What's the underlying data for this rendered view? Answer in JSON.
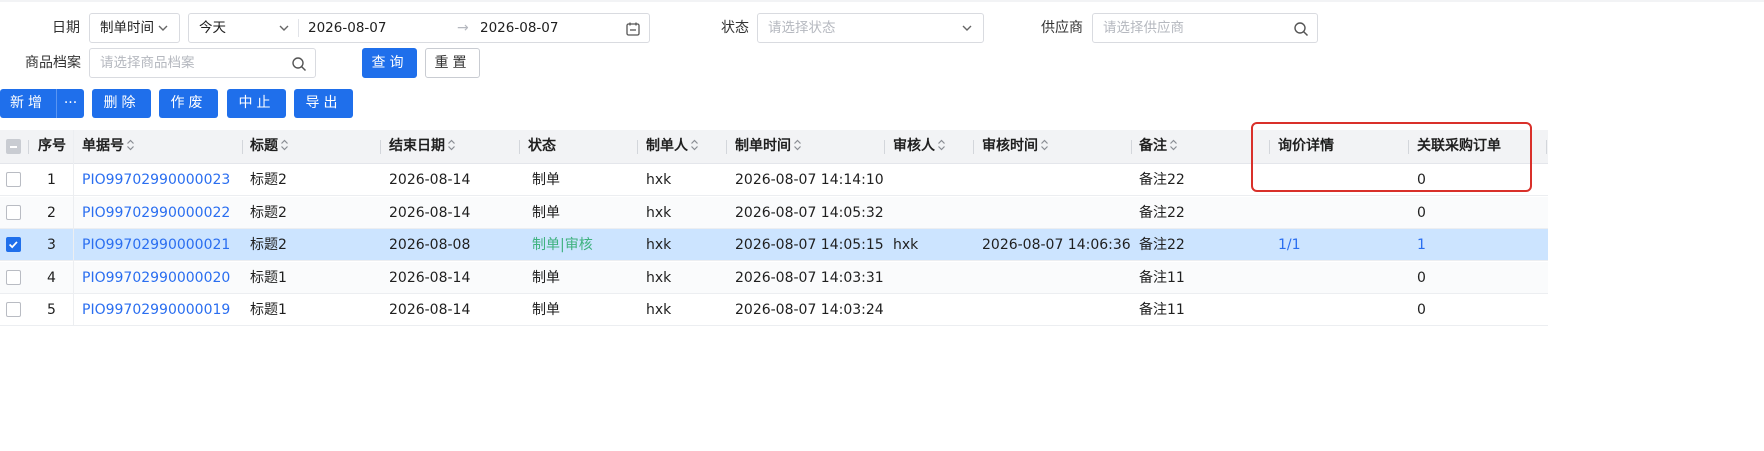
{
  "filters": {
    "date_label": "日期",
    "date_type_value": "制单时间",
    "date_preset_value": "今天",
    "start_date": "2026-08-07",
    "end_date": "2026-08-07",
    "status_label": "状态",
    "status_placeholder": "请选择状态",
    "supplier_label": "供应商",
    "supplier_placeholder": "请选择供应商",
    "product_label": "商品档案",
    "product_placeholder": "请选择商品档案",
    "query_button": "查询",
    "reset_button": "重置"
  },
  "toolbar": {
    "add": "新增",
    "more": "···",
    "delete": "删除",
    "void": "作废",
    "stop": "中止",
    "export": "导出"
  },
  "table": {
    "headers": {
      "index": "序号",
      "doc_no": "单据号",
      "title": "标题",
      "end_date": "结束日期",
      "status": "状态",
      "creator": "制单人",
      "created_at": "制单时间",
      "reviewer": "审核人",
      "reviewed_at": "审核时间",
      "remark": "备注",
      "inquiry_detail": "询价详情",
      "related_po": "关联采购订单"
    },
    "rows": [
      {
        "index": "1",
        "doc_no": "PIO99702990000023",
        "title": "标题2",
        "end_date": "2026-08-14",
        "status": "制单",
        "creator": "hxk",
        "created_at": "2026-08-07 14:14:10",
        "reviewer": "",
        "reviewed_at": "",
        "remark": "备注22",
        "inquiry_detail": "",
        "related_po": "0",
        "checked": false
      },
      {
        "index": "2",
        "doc_no": "PIO99702990000022",
        "title": "标题2",
        "end_date": "2026-08-14",
        "status": "制单",
        "creator": "hxk",
        "created_at": "2026-08-07 14:05:32",
        "reviewer": "",
        "reviewed_at": "",
        "remark": "备注22",
        "inquiry_detail": "",
        "related_po": "0",
        "checked": false
      },
      {
        "index": "3",
        "doc_no": "PIO99702990000021",
        "title": "标题2",
        "end_date": "2026-08-08",
        "status": "制单|审核",
        "creator": "hxk",
        "created_at": "2026-08-07 14:05:15",
        "reviewer": "hxk",
        "reviewed_at": "2026-08-07 14:06:36",
        "remark": "备注22",
        "inquiry_detail": "1/1",
        "related_po": "1",
        "checked": true
      },
      {
        "index": "4",
        "doc_no": "PIO99702990000020",
        "title": "标题1",
        "end_date": "2026-08-14",
        "status": "制单",
        "creator": "hxk",
        "created_at": "2026-08-07 14:03:31",
        "reviewer": "",
        "reviewed_at": "",
        "remark": "备注11",
        "inquiry_detail": "",
        "related_po": "0",
        "checked": false
      },
      {
        "index": "5",
        "doc_no": "PIO99702990000019",
        "title": "标题1",
        "end_date": "2026-08-14",
        "status": "制单",
        "creator": "hxk",
        "created_at": "2026-08-07 14:03:24",
        "reviewer": "",
        "reviewed_at": "",
        "remark": "备注11",
        "inquiry_detail": "",
        "related_po": "0",
        "checked": false
      }
    ]
  },
  "colors": {
    "primary": "#1f6feb",
    "link": "#2a6ef0",
    "selected_row": "#cce4ff",
    "highlight": "#d9302a",
    "status_reviewed": "#3fb27f"
  }
}
